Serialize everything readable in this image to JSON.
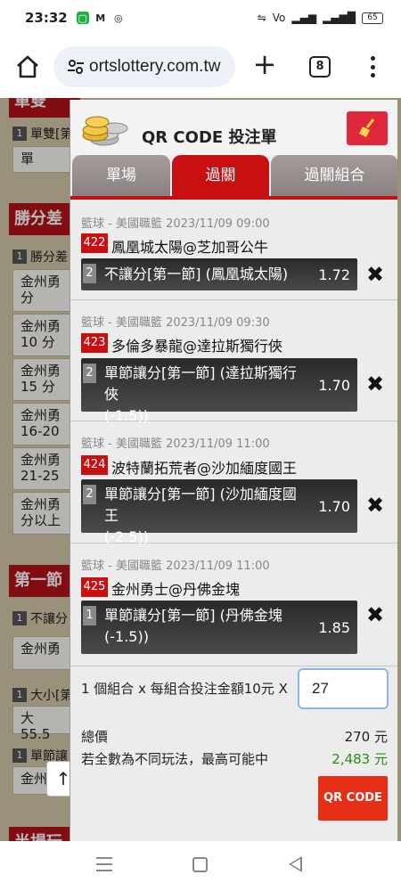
{
  "status_bar": {
    "time": "23:32",
    "left_icons": [
      "messaging-icon",
      "gmail-icon",
      "instagram-icon"
    ],
    "right_icons": [
      "vibrate-icon",
      "volte-icon",
      "signal-4g-icon",
      "wifi-signal-icon"
    ],
    "battery": "65"
  },
  "browser": {
    "url": "ortslottery.com.tw",
    "tab_count": "8"
  },
  "background_page": {
    "sections": [
      {
        "head": "單雙",
        "rows": [
          {
            "num": "1",
            "label": "單雙[第"
          }
        ],
        "cells": [
          "單"
        ]
      },
      {
        "head": "勝分差",
        "rows": [
          {
            "num": "1",
            "label": "勝分差"
          }
        ],
        "cells": [
          "金州勇\n分",
          "金州勇\n10 分",
          "金州勇\n15 分",
          "金州勇\n16-20",
          "金州勇\n21-25",
          "金州勇\n分以上"
        ]
      },
      {
        "head": "第一節",
        "rows": [
          {
            "num": "1",
            "label": "不讓分"
          },
          {
            "num": "1",
            "label": "大小[第"
          },
          {
            "num": "1",
            "label": "單節讓"
          }
        ],
        "cells": [
          "金州勇",
          "大 55.5",
          "金州"
        ]
      },
      {
        "head": "半場玩"
      }
    ],
    "scroll_up": "↑"
  },
  "slip": {
    "title": "QR CODE 投注單",
    "tabs": [
      {
        "label": "單場",
        "active": false
      },
      {
        "label": "過關",
        "active": true
      },
      {
        "label": "過關組合",
        "active": false
      }
    ],
    "matches": [
      {
        "meta": "籃球 - 美國職籃 2023/11/09 09:00",
        "id": "422",
        "teams": "鳳凰城太陽@芝加哥公牛",
        "bet_num": "2",
        "bet_line1": "不讓分[第一節] (鳳凰城太陽)",
        "bet_line2": "",
        "odds": "1.72"
      },
      {
        "meta": "籃球 - 美國職籃 2023/11/09 09:30",
        "id": "423",
        "teams": "多倫多暴龍@達拉斯獨行俠",
        "bet_num": "2",
        "bet_line1": "單節讓分[第一節] (達拉斯獨行俠",
        "bet_line2": "(-1.5))",
        "odds": "1.70"
      },
      {
        "meta": "籃球 - 美國職籃 2023/11/09 11:00",
        "id": "424",
        "teams": "波特蘭拓荒者@沙加緬度國王",
        "bet_num": "2",
        "bet_line1": "單節讓分[第一節] (沙加緬度國王",
        "bet_line2": "(-2.5))",
        "odds": "1.70"
      },
      {
        "meta": "籃球 - 美國職籃 2023/11/09 11:00",
        "id": "425",
        "teams": "金州勇士@丹佛金塊",
        "bet_num": "1",
        "bet_line1": "單節讓分[第一節] (丹佛金塊",
        "bet_line2": "(-1.5))",
        "odds": "1.85"
      }
    ],
    "remove_symbol": "✖",
    "combo_text": "1 個組合 x 每組合投注金額10元 X",
    "multiplier_value": "27",
    "total_label": "總價",
    "total_value": "270 元",
    "max_label": "若全數為不同玩法，最高可能中",
    "max_value": "2,483 元",
    "qr_button": "QR CODE",
    "colors": {
      "accent": "#c80f12",
      "win": "#2d8a1a",
      "qr_button": "#e62f14"
    }
  },
  "nav": {
    "buttons": [
      "recent-apps",
      "home",
      "back"
    ]
  }
}
